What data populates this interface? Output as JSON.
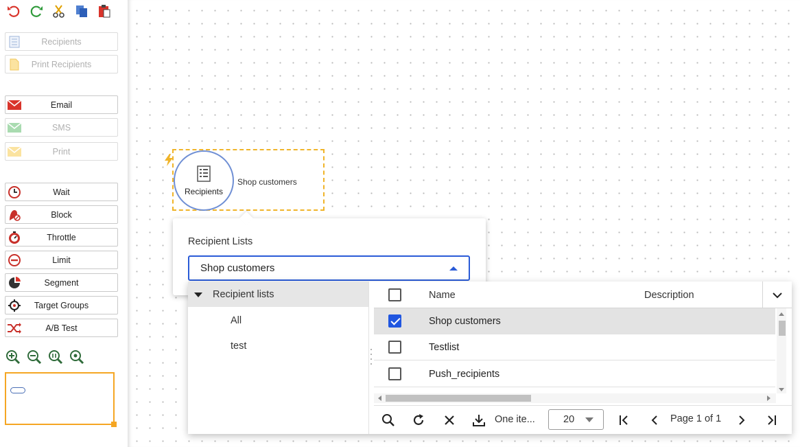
{
  "toolbar": {
    "top_icons": [
      "undo-icon",
      "redo-icon",
      "cut-icon",
      "copy-icon",
      "paste-icon"
    ],
    "buttons": [
      {
        "label": "Recipients",
        "icon": "recipients-icon",
        "enabled": false
      },
      {
        "label": "Print Recipients",
        "icon": "print-recipients-icon",
        "enabled": false
      },
      {
        "label": "Email",
        "icon": "email-icon",
        "enabled": true
      },
      {
        "label": "SMS",
        "icon": "sms-icon",
        "enabled": false
      },
      {
        "label": "Print",
        "icon": "print-icon",
        "enabled": false
      },
      {
        "label": "Wait",
        "icon": "clock-icon",
        "enabled": true
      },
      {
        "label": "Block",
        "icon": "block-icon",
        "enabled": true
      },
      {
        "label": "Throttle",
        "icon": "throttle-icon",
        "enabled": true
      },
      {
        "label": "Limit",
        "icon": "limit-icon",
        "enabled": true
      },
      {
        "label": "Segment",
        "icon": "segment-icon",
        "enabled": true
      },
      {
        "label": "Target Groups",
        "icon": "target-icon",
        "enabled": true
      },
      {
        "label": "A/B Test",
        "icon": "shuffle-icon",
        "enabled": true
      }
    ],
    "zoom_icons": [
      "zoom-in-icon",
      "zoom-out-icon",
      "zoom-fit-icon",
      "zoom-reset-icon"
    ]
  },
  "node": {
    "label": "Recipients",
    "name": "Shop customers",
    "icon": "recipients-icon"
  },
  "popup": {
    "label": "Recipient Lists",
    "selected_value": "Shop customers"
  },
  "tree": {
    "root": "Recipient lists",
    "children": [
      "All",
      "test"
    ]
  },
  "grid": {
    "headers": {
      "name": "Name",
      "description": "Description"
    },
    "rows": [
      {
        "name": "Shop customers",
        "description": "",
        "checked": true
      },
      {
        "name": "Testlist",
        "description": "",
        "checked": false
      },
      {
        "name": "Push_recipients",
        "description": "",
        "checked": false
      }
    ]
  },
  "pager": {
    "info": "One ite...",
    "page_size": "20",
    "page_info": "Page 1 of 1"
  },
  "colors": {
    "accent": "#2a5bd7",
    "node_border": "#f0b429",
    "checkbox": "#2056e0"
  }
}
